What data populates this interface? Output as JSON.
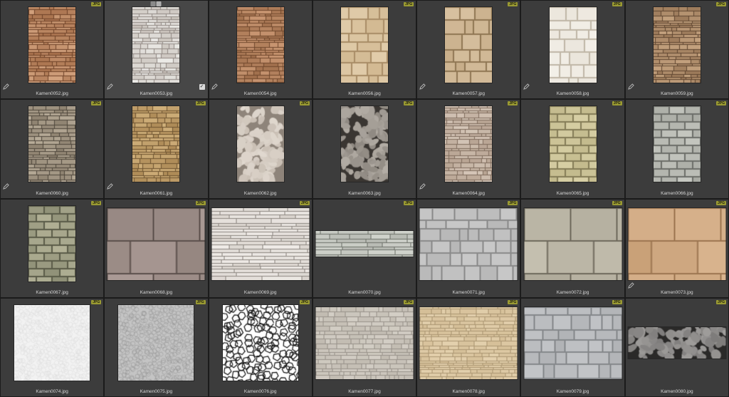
{
  "badge_label": "JPG",
  "items": [
    {
      "name": "Kamen0052.jpg",
      "shape": "portrait",
      "badge": true,
      "pencil": true,
      "tex": {
        "t": "ledge",
        "c1": "#a8714c",
        "c2": "#6e4228",
        "c3": "#d2a27e"
      }
    },
    {
      "name": "Kamen0053.jpg",
      "shape": "portrait",
      "badge": false,
      "pencil": true,
      "selected": true,
      "checked": true,
      "tools": true,
      "tex": {
        "t": "ledge",
        "c1": "#c9c2bb",
        "c2": "#8f8782",
        "c3": "#ecebe8"
      }
    },
    {
      "name": "Kamen0054.jpg",
      "shape": "portrait",
      "badge": false,
      "pencil": true,
      "tex": {
        "t": "ledge",
        "c1": "#a06f4c",
        "c2": "#6f472c",
        "c3": "#c99672"
      }
    },
    {
      "name": "Kamen0056.jpg",
      "shape": "portrait",
      "badge": true,
      "pencil": false,
      "tex": {
        "t": "blocks",
        "c1": "#d2b992",
        "c2": "#a88c66",
        "c3": "#e6d3b3"
      }
    },
    {
      "name": "Kamen0057.jpg",
      "shape": "portrait",
      "badge": true,
      "pencil": true,
      "tex": {
        "t": "blocks",
        "c1": "#c7ad89",
        "c2": "#8f7653",
        "c3": "#dcc6a6"
      }
    },
    {
      "name": "Kamen0058.jpg",
      "shape": "portrait",
      "badge": true,
      "pencil": true,
      "tex": {
        "t": "blocks",
        "c1": "#ebe6dc",
        "c2": "#bfb6a6",
        "c3": "#f6f3ed"
      }
    },
    {
      "name": "Kamen0059.jpg",
      "shape": "portrait",
      "badge": true,
      "pencil": true,
      "tex": {
        "t": "ledge",
        "c1": "#9a7858",
        "c2": "#5e4530",
        "c3": "#c4a27f"
      }
    },
    {
      "name": "Kamen0060.jpg",
      "shape": "portrait",
      "badge": true,
      "pencil": true,
      "tex": {
        "t": "ledge",
        "c1": "#8f8371",
        "c2": "#4e463b",
        "c3": "#b9ad9a"
      }
    },
    {
      "name": "Kamen0061.jpg",
      "shape": "portrait",
      "badge": true,
      "pencil": true,
      "tex": {
        "t": "ledge",
        "c1": "#ad8a56",
        "c2": "#6d5330",
        "c3": "#cfaf7a"
      }
    },
    {
      "name": "Kamen0062.jpg",
      "shape": "portrait",
      "badge": true,
      "pencil": false,
      "tex": {
        "t": "cobble",
        "c1": "#c8beb3",
        "c2": "#8e847a",
        "c3": "#e0d8cf"
      }
    },
    {
      "name": "Kamen0063.jpg",
      "shape": "portrait",
      "badge": true,
      "pencil": false,
      "tex": {
        "t": "cobble",
        "c1": "#8d8780",
        "c2": "#3a3632",
        "c3": "#b3ada5"
      }
    },
    {
      "name": "Kamen0064.jpg",
      "shape": "portrait",
      "badge": true,
      "pencil": true,
      "tex": {
        "t": "ledge",
        "c1": "#b8a493",
        "c2": "#7f6c5d",
        "c3": "#d5c6b8"
      }
    },
    {
      "name": "Kamen0065.jpg",
      "shape": "portrait",
      "badge": true,
      "pencil": false,
      "tex": {
        "t": "brick",
        "c1": "#c2b98c",
        "c2": "#847c57",
        "c3": "#d8d0a6"
      }
    },
    {
      "name": "Kamen0066.jpg",
      "shape": "portrait",
      "badge": true,
      "pencil": false,
      "tex": {
        "t": "brick",
        "c1": "#a9aba4",
        "c2": "#6c6e69",
        "c3": "#c6c8c1"
      }
    },
    {
      "name": "Kamen0067.jpg",
      "shape": "portrait",
      "badge": true,
      "pencil": false,
      "tex": {
        "t": "brick",
        "c1": "#8f9077",
        "c2": "#5a5b48",
        "c3": "#b3b297"
      }
    },
    {
      "name": "Kamen0068.jpg",
      "shape": "landscape",
      "badge": true,
      "pencil": false,
      "tex": {
        "t": "bigbrick",
        "c1": "#8a7b76",
        "c2": "#5b4f4b",
        "c3": "#b3a39d"
      }
    },
    {
      "name": "Kamen0069.jpg",
      "shape": "landscape",
      "badge": true,
      "pencil": false,
      "tex": {
        "t": "slats",
        "c1": "#d8d2cc",
        "c2": "#8c8680",
        "c3": "#efebe7"
      }
    },
    {
      "name": "Kamen0070.jpg",
      "shape": "wide",
      "badge": true,
      "pencil": false,
      "tex": {
        "t": "slats",
        "c1": "#b6b9b2",
        "c2": "#6d716a",
        "c3": "#d3d6cf"
      }
    },
    {
      "name": "Kamen0071.jpg",
      "shape": "landscape",
      "badge": true,
      "pencil": false,
      "tex": {
        "t": "blocks",
        "c1": "#b7b7b7",
        "c2": "#8a8a8a",
        "c3": "#cdcdcd"
      }
    },
    {
      "name": "Kamen0072.jpg",
      "shape": "landscape",
      "badge": true,
      "pencil": false,
      "tex": {
        "t": "bigbrick",
        "c1": "#a7a292",
        "c2": "#6e695c",
        "c3": "#c6c1b1"
      }
    },
    {
      "name": "Kamen0073.jpg",
      "shape": "landscape",
      "badge": true,
      "pencil": true,
      "tex": {
        "t": "bigbrick",
        "c1": "#c79f76",
        "c2": "#9c7550",
        "c3": "#dab590"
      }
    },
    {
      "name": "Kamen0074.jpg",
      "shape": "square",
      "badge": true,
      "pencil": false,
      "tex": {
        "t": "cells",
        "c1": "#f2f2f2",
        "c2": "#d8d8d8",
        "c3": "#ffffff"
      }
    },
    {
      "name": "Kamen0075.jpg",
      "shape": "square",
      "badge": true,
      "pencil": false,
      "tex": {
        "t": "cells",
        "c1": "#c4c4c4",
        "c2": "#8e8e8e",
        "c3": "#d8d8d8"
      }
    },
    {
      "name": "Kamen0076.jpg",
      "shape": "square",
      "badge": true,
      "pencil": false,
      "tex": {
        "t": "voronoi",
        "c1": "#ffffff",
        "c2": "#111111",
        "c3": "#ffffff"
      }
    },
    {
      "name": "Kamen0077.jpg",
      "shape": "landscape",
      "badge": true,
      "pencil": false,
      "tex": {
        "t": "ledge",
        "c1": "#c2bcb2",
        "c2": "#98928a",
        "c3": "#d3cec5"
      }
    },
    {
      "name": "Kamen0078.jpg",
      "shape": "landscape",
      "badge": true,
      "pencil": false,
      "tex": {
        "t": "ledge",
        "c1": "#d5bf98",
        "c2": "#ab9672",
        "c3": "#e3d0ad"
      }
    },
    {
      "name": "Kamen0079.jpg",
      "shape": "landscape",
      "badge": true,
      "pencil": false,
      "tex": {
        "t": "blocks",
        "c1": "#b1b3b6",
        "c2": "#85888b",
        "c3": "#c6c8cb"
      }
    },
    {
      "name": "Kamen0080.jpg",
      "shape": "strip",
      "badge": true,
      "pencil": false,
      "tex": {
        "t": "cobble",
        "c1": "#7d7b7a",
        "c2": "#2a2928",
        "c3": "#9f9d9b"
      }
    }
  ]
}
